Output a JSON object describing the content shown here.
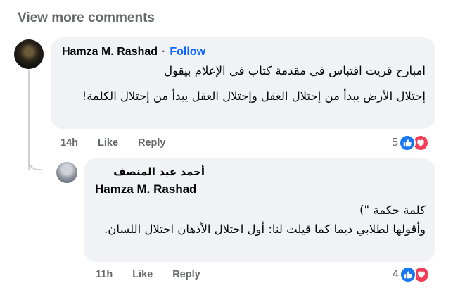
{
  "view_more": "View more comments",
  "comment1": {
    "author": "Hamza M. Rashad",
    "separator": "·",
    "follow": "Follow",
    "line1": "امبارح قريت اقتباس في مقدمة كتاب في الإعلام بيقول",
    "para2": "إحتلال الأرض يبدأ من إحتلال العقل وإحتلال العقل يبدأ من إحتلال الكلمة!",
    "time": "14h",
    "like": "Like",
    "reply": "Reply",
    "reaction_count": "5",
    "reactions": [
      "like-icon",
      "love-icon"
    ]
  },
  "comment2": {
    "author": "أحمد عبد المنصف",
    "tag": "Hamza M. Rashad",
    "text": "كلمة حكمة \")\nوأقولها لطلابي ديما كما قيلت لنا: أول احتلال الأذهان احتلال اللسان.",
    "time": "11h",
    "like": "Like",
    "reply": "Reply",
    "reaction_count": "4",
    "reactions": [
      "like-icon",
      "love-icon"
    ]
  },
  "colors": {
    "bubble": "#f0f2f5",
    "secondary_text": "#65676b",
    "follow": "#0866ff",
    "like": "#1877f2",
    "love": "#f33e58"
  }
}
